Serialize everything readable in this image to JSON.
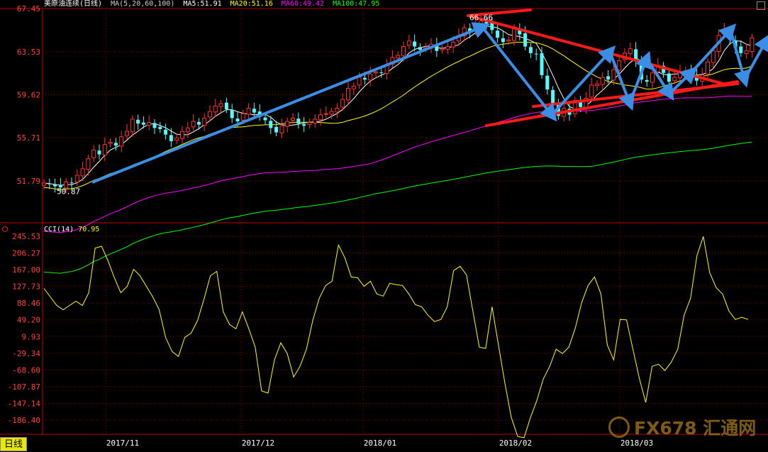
{
  "header": {
    "symbol": "美原油连续(日线)",
    "ma_params": "MA(5,20,60,100)",
    "ma5": "MA5:51.91",
    "ma20": "MA20:51.16",
    "ma60": "MA60:49.42",
    "ma100": "MA100:47.95"
  },
  "cci_header": {
    "label": "CCI(14)",
    "value": "70.95"
  },
  "period_button": "日线",
  "watermark": "FX678 汇通网",
  "colors": {
    "bg": "#000000",
    "up": "#ff3232",
    "down": "#54fcfc",
    "grid": "#8b0000",
    "axis": "#c00000",
    "ma5": "#ffffff",
    "ma20": "#ffff00",
    "ma60": "#ff00ff",
    "ma100": "#00ff00",
    "cci": "#ffff00",
    "blue_arrow": "#3b8ee6",
    "red_line": "#ff1a1a"
  },
  "chart_data": [
    {
      "type": "candlestick",
      "title": "美原油连续(日线)",
      "y_ticks": [
        "67.45",
        "63.53",
        "59.62",
        "55.71",
        "51.79"
      ],
      "x_ticks": [
        "2017/11",
        "2017/12",
        "2018/01",
        "2018/02",
        "2018/03"
      ],
      "ylim": [
        48.0,
        67.6
      ],
      "annotations": [
        {
          "text": "66.66",
          "value": 66.66
        },
        {
          "text": "50.87",
          "value": 50.87
        }
      ],
      "series": [
        {
          "name": "MA5",
          "value": 51.91
        },
        {
          "name": "MA20",
          "value": 51.16
        },
        {
          "name": "MA60",
          "value": 49.42
        },
        {
          "name": "MA100",
          "value": 47.95
        }
      ],
      "closes": [
        51.6,
        51.5,
        51.3,
        51.2,
        51.7,
        51.6,
        52.3,
        52.9,
        53.8,
        54.6,
        54.2,
        55.1,
        55.3,
        55.0,
        55.8,
        56.3,
        57.4,
        57.0,
        56.9,
        57.1,
        56.6,
        56.5,
        56.0,
        55.4,
        55.7,
        56.3,
        56.6,
        57.2,
        56.9,
        57.5,
        58.1,
        58.6,
        58.8,
        58.3,
        57.5,
        57.2,
        57.9,
        58.4,
        58.0,
        57.6,
        57.3,
        56.6,
        56.2,
        56.8,
        57.2,
        57.5,
        57.0,
        56.8,
        57.1,
        57.4,
        57.8,
        57.9,
        58.1,
        58.4,
        59.2,
        60.2,
        60.4,
        61.2,
        61.0,
        61.5,
        61.7,
        61.6,
        62.3,
        63.0,
        63.2,
        64.0,
        64.5,
        64.0,
        63.7,
        63.9,
        64.2,
        63.6,
        63.8,
        64.0,
        64.4,
        65.0,
        65.7,
        65.3,
        65.8,
        66.3,
        66.1,
        65.5,
        64.8,
        64.4,
        64.6,
        65.6,
        65.1,
        64.0,
        63.4,
        63.3,
        61.4,
        60.1,
        58.7,
        57.7,
        58.4,
        57.8,
        59.1,
        58.5,
        59.3,
        60.5,
        60.6,
        61.2,
        61.0,
        61.9,
        62.7,
        63.4,
        63.8,
        62.7,
        61.0,
        60.8,
        61.6,
        62.3,
        61.6,
        60.8,
        61.2,
        61.7,
        61.8,
        61.5,
        60.9,
        61.4,
        62.6,
        63.6,
        65.0,
        65.5,
        64.6,
        63.9,
        63.4,
        63.6,
        64.8
      ],
      "cci": [
        123,
        103,
        83,
        73,
        83,
        93,
        83,
        113,
        218,
        222,
        188,
        148,
        113,
        128,
        168,
        153,
        128,
        103,
        73,
        8,
        -25,
        -37,
        8,
        18,
        48,
        98,
        153,
        163,
        68,
        38,
        28,
        68,
        28,
        -15,
        -118,
        -123,
        -45,
        -5,
        -30,
        -85,
        -60,
        -20,
        48,
        100,
        130,
        140,
        225,
        195,
        150,
        148,
        128,
        140,
        110,
        105,
        135,
        132,
        130,
        110,
        85,
        80,
        60,
        45,
        50,
        80,
        165,
        175,
        155,
        70,
        -15,
        -18,
        80,
        -10,
        -100,
        -180,
        -225,
        -228,
        -180,
        -140,
        -90,
        -60,
        -20,
        -30,
        -15,
        30,
        90,
        130,
        150,
        110,
        -10,
        -45,
        50,
        49,
        -20,
        -88,
        -145,
        -60,
        -55,
        -70,
        -50,
        -20,
        60,
        100,
        200,
        245,
        160,
        125,
        110,
        70,
        50,
        55,
        50
      ]
    }
  ]
}
